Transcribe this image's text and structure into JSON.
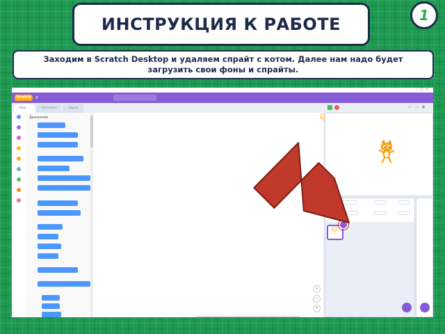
{
  "slide": {
    "title": "ИНСТРУКЦИЯ К РАБОТЕ",
    "number": "1",
    "description": "Заходим в Scratch Desktop и удаляем спрайт с котом. Далее нам надо будет загрузить свои фоны и спрайты."
  },
  "colors": {
    "background": "#1f9a52",
    "border": "#1c2a4a",
    "scratch_purple": "#855cd6",
    "arrow_red": "#c0392b"
  },
  "scratch": {
    "logo": "Scratch",
    "tabs": [
      "Код",
      "Костюмы",
      "Звуки"
    ],
    "palette_title": "Движение",
    "icons": [
      "green-flag-icon",
      "stop-icon",
      "cat-sprite-icon",
      "delete-sprite-icon",
      "zoom-in-icon",
      "zoom-out-icon"
    ]
  }
}
